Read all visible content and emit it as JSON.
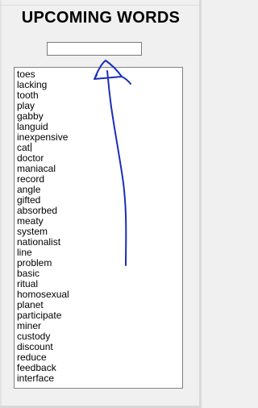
{
  "header": {
    "title": "UPCOMING WORDS"
  },
  "input": {
    "value": ""
  },
  "words": [
    "toes",
    "lacking",
    "tooth",
    "play",
    "gabby",
    "languid",
    "inexpensive",
    "cat",
    "doctor",
    "maniacal",
    "record",
    "angle",
    "gifted",
    "absorbed",
    "meaty",
    "system",
    "nationalist",
    "line",
    "problem",
    "basic",
    "ritual",
    "homosexual",
    "planet",
    "participate",
    "miner",
    "custody",
    "discount",
    "reduce",
    "feedback",
    "interface"
  ],
  "annotation": {
    "color": "#1a2fb8",
    "shape": "hand-drawn-arrow"
  }
}
